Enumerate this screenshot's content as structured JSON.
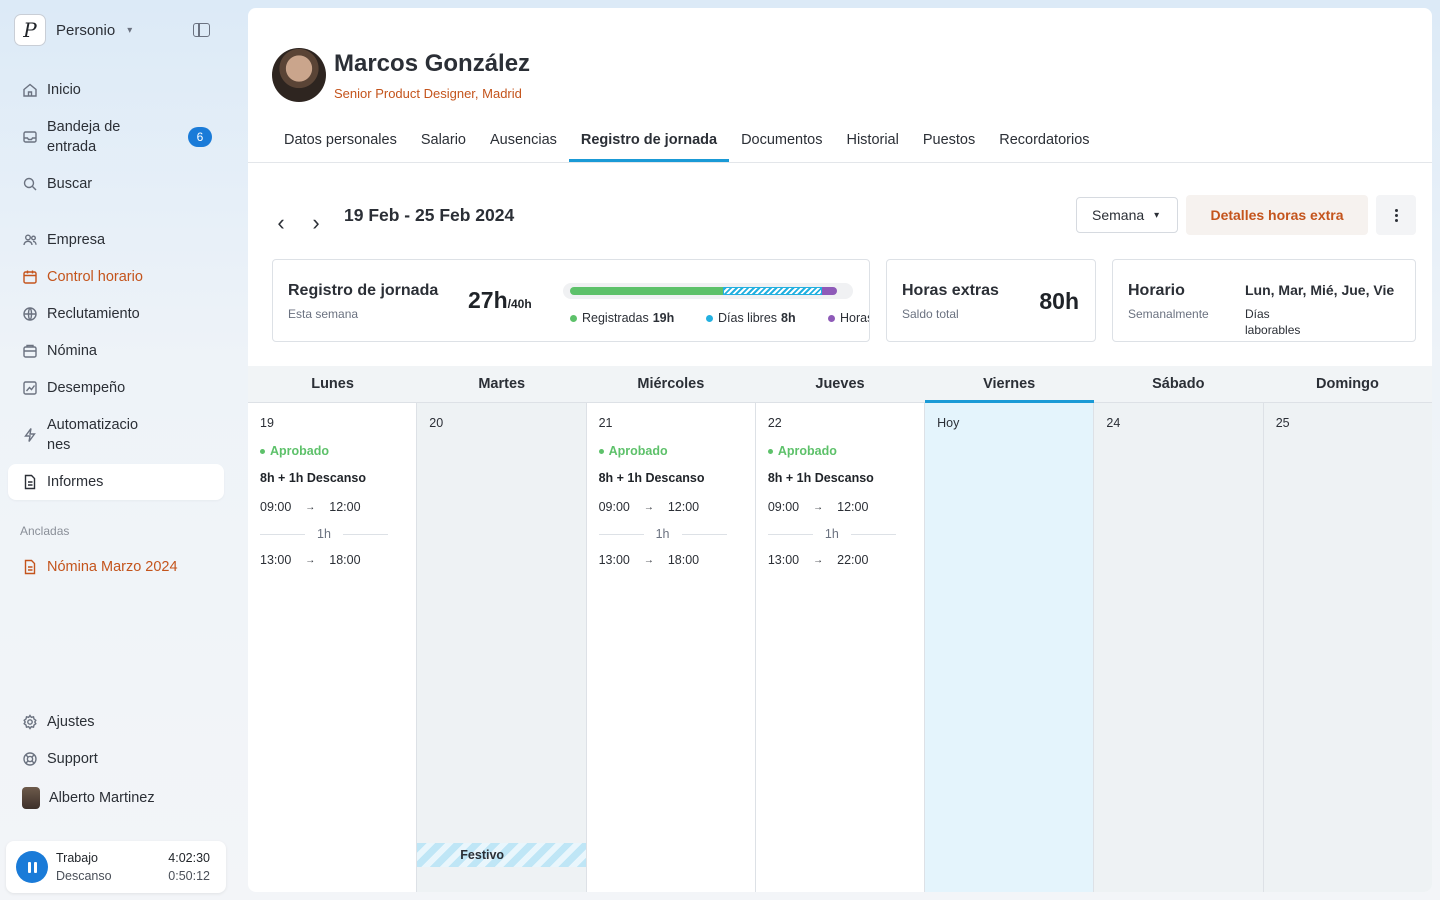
{
  "app": {
    "name": "Personio"
  },
  "sidebar": {
    "items": [
      {
        "label": "Inicio",
        "icon": "home-icon"
      },
      {
        "label": "Bandeja de entrada",
        "icon": "inbox-icon",
        "badge": "6"
      },
      {
        "label": "Buscar",
        "icon": "search-icon"
      },
      {
        "label": "Empresa",
        "icon": "people-icon"
      },
      {
        "label": "Control horario",
        "icon": "calendar-icon"
      },
      {
        "label": "Reclutamiento",
        "icon": "globe-icon"
      },
      {
        "label": "Nómina",
        "icon": "payroll-icon"
      },
      {
        "label": "Desempeño",
        "icon": "chart-icon"
      },
      {
        "label": "Automatizaciones",
        "icon": "lightning-icon"
      },
      {
        "label": "Informes",
        "icon": "document-icon"
      }
    ],
    "pinned_label": "Ancladas",
    "pinned_items": [
      {
        "label": "Nómina Marzo 2024",
        "icon": "document-icon"
      }
    ],
    "bottom": [
      {
        "label": "Ajustes",
        "icon": "gear-icon"
      },
      {
        "label": "Support",
        "icon": "lifebuoy-icon"
      },
      {
        "label": "Alberto Martinez",
        "icon": "avatar"
      }
    ],
    "timer": {
      "work_label": "Trabajo",
      "work_value": "4:02:30",
      "break_label": "Descanso",
      "break_value": "0:50:12"
    }
  },
  "profile": {
    "name": "Marcos González",
    "role": "Senior Product Designer, Madrid"
  },
  "tabs": [
    {
      "label": "Datos personales"
    },
    {
      "label": "Salario"
    },
    {
      "label": "Ausencias"
    },
    {
      "label": "Registro de jornada",
      "active": true
    },
    {
      "label": "Documentos"
    },
    {
      "label": "Historial"
    },
    {
      "label": "Puestos"
    },
    {
      "label": "Recordatorios"
    }
  ],
  "toolbar": {
    "range": "19 Feb - 25 Feb 2024",
    "view_select": "Semana",
    "extra_button": "Detalles horas extra"
  },
  "cards": {
    "attendance": {
      "title": "Registro de jornada",
      "sub": "Esta semana",
      "value": "27h",
      "value_suffix": "/40h",
      "progress": {
        "registered_fraction": 0.553,
        "days_off_fraction": 0.359,
        "overtime_fraction": 0.057
      },
      "legend": [
        {
          "label": "Registradas",
          "value": "19h",
          "color": "#5dc16a"
        },
        {
          "label": "Días libres",
          "value": "8h",
          "color": "#23b0e0"
        },
        {
          "label": "Horas extra",
          "value": "",
          "color": "#8e5ab8"
        }
      ]
    },
    "overtime": {
      "title": "Horas extras",
      "sub": "Saldo total",
      "value": "80h"
    },
    "schedule": {
      "title": "Horario",
      "sub": "Semanalmente",
      "days": "Lun, Mar, Mié, Jue, Vie",
      "days_sub": "Días laborables"
    }
  },
  "calendar": {
    "days": [
      "Lunes",
      "Martes",
      "Miércoles",
      "Jueves",
      "Viernes",
      "Sábado",
      "Domingo"
    ],
    "today_label": "Hoy",
    "holiday_label": "Festivo",
    "status_label": "Aprobado",
    "summary": "8h + 1h Descanso",
    "break_duration": "1h",
    "entries": {
      "mon": {
        "date": "19",
        "start1": "09:00",
        "end1": "12:00",
        "start2": "13:00",
        "end2": "18:00"
      },
      "tue": {
        "date": "20"
      },
      "wed": {
        "date": "21",
        "start1": "09:00",
        "end1": "12:00",
        "start2": "13:00",
        "end2": "18:00"
      },
      "thu": {
        "date": "22",
        "start1": "09:00",
        "end1": "12:00",
        "start2": "13:00",
        "end2": "22:00"
      },
      "sat": {
        "date": "24"
      },
      "sun": {
        "date": "25"
      }
    }
  },
  "colors": {
    "accent": "#1a9ad6",
    "brand_orange": "#c4541c",
    "badge_blue": "#1a7bd8",
    "approved_green": "#5dc16a"
  }
}
